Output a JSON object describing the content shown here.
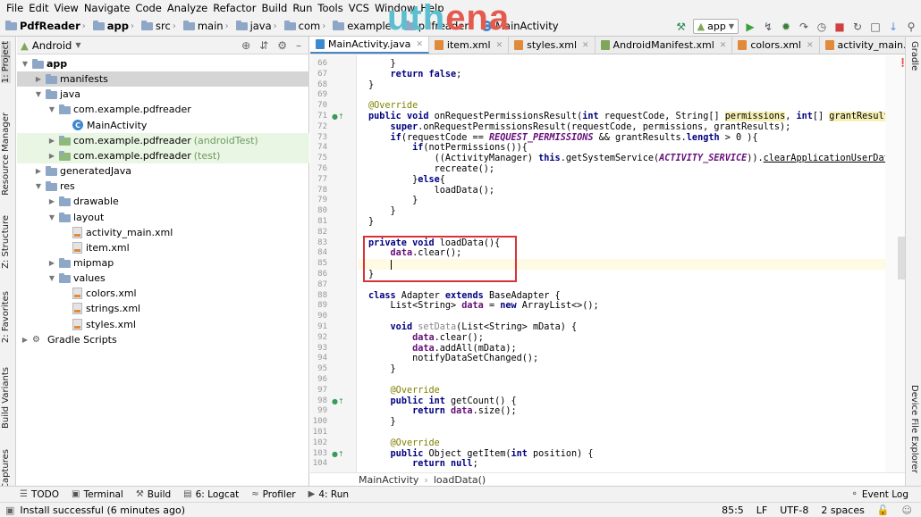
{
  "menu": [
    "File",
    "Edit",
    "View",
    "Navigate",
    "Code",
    "Analyze",
    "Refactor",
    "Build",
    "Run",
    "Tools",
    "VCS",
    "Window",
    "Help"
  ],
  "breadcrumbs": [
    "PdfReader",
    "app",
    "src",
    "main",
    "java",
    "com",
    "example",
    "pdfreader",
    "MainActivity"
  ],
  "watermark": {
    "part1": "uth",
    "part2": "ena"
  },
  "run_config": "app",
  "left_tool_windows": [
    "1: Project",
    "Resource Manager",
    "Z: Structure",
    "2: Favorites",
    "Build Variants",
    "Captures"
  ],
  "right_tool_windows": [
    "Gradle",
    "Device File Explorer"
  ],
  "project": {
    "view_mode": "Android",
    "tree": [
      {
        "label": "app",
        "level": 0,
        "icon": "folder",
        "expanded": true,
        "bold": true
      },
      {
        "label": "manifests",
        "level": 1,
        "icon": "folder",
        "expanded": false,
        "selected": true
      },
      {
        "label": "java",
        "level": 1,
        "icon": "folder",
        "expanded": true
      },
      {
        "label": "com.example.pdfreader",
        "level": 2,
        "icon": "folder",
        "expanded": true
      },
      {
        "label": "MainActivity",
        "level": 3,
        "icon": "class",
        "leaf": true
      },
      {
        "label": "com.example.pdfreader",
        "suffix": "(androidTest)",
        "level": 2,
        "icon": "folder",
        "expanded": false,
        "highlight": true
      },
      {
        "label": "com.example.pdfreader",
        "suffix": "(test)",
        "level": 2,
        "icon": "folder",
        "expanded": false,
        "highlight": true
      },
      {
        "label": "generatedJava",
        "level": 1,
        "icon": "folder",
        "expanded": false
      },
      {
        "label": "res",
        "level": 1,
        "icon": "folder",
        "expanded": true
      },
      {
        "label": "drawable",
        "level": 2,
        "icon": "folder",
        "expanded": false
      },
      {
        "label": "layout",
        "level": 2,
        "icon": "folder",
        "expanded": true
      },
      {
        "label": "activity_main.xml",
        "level": 3,
        "icon": "xml",
        "leaf": true
      },
      {
        "label": "item.xml",
        "level": 3,
        "icon": "xml",
        "leaf": true
      },
      {
        "label": "mipmap",
        "level": 2,
        "icon": "folder",
        "expanded": false
      },
      {
        "label": "values",
        "level": 2,
        "icon": "folder",
        "expanded": true
      },
      {
        "label": "colors.xml",
        "level": 3,
        "icon": "xml",
        "leaf": true
      },
      {
        "label": "strings.xml",
        "level": 3,
        "icon": "xml",
        "leaf": true
      },
      {
        "label": "styles.xml",
        "level": 3,
        "icon": "xml",
        "leaf": true
      },
      {
        "label": "Gradle Scripts",
        "level": 0,
        "icon": "gradle",
        "expanded": false
      }
    ]
  },
  "tabs": [
    {
      "label": "MainActivity.java",
      "active": true,
      "color": "#3c89d0"
    },
    {
      "label": "item.xml",
      "color": "#e08a3a"
    },
    {
      "label": "styles.xml",
      "color": "#e08a3a"
    },
    {
      "label": "AndroidManifest.xml",
      "color": "#7fa65a"
    },
    {
      "label": "colors.xml",
      "color": "#e08a3a"
    },
    {
      "label": "activity_main.xml",
      "color": "#e08a3a"
    }
  ],
  "code": [
    {
      "n": "66",
      "t": "    }",
      "ovr": false
    },
    {
      "n": "67",
      "t": "    «return» «false»;"
    },
    {
      "n": "68",
      "t": "}"
    },
    {
      "n": "69",
      "t": ""
    },
    {
      "n": "70",
      "t": "⟨@Override⟩"
    },
    {
      "n": "71",
      "t": "«public» «void» onRequestPermissionsResult(«int» requestCode, String[] ‹permissions›, «int»[] ‹grantResults›){",
      "ovr": true
    },
    {
      "n": "72",
      "t": "    «super».onRequestPermissionsResult(requestCode, permissions, grantResults);"
    },
    {
      "n": "73",
      "t": "    «if»(requestCode == ⁅REQUEST_PERMISSIONS⁆ && grantResults.«length» > 0 ){"
    },
    {
      "n": "74",
      "t": "        «if»(notPermissions()){"
    },
    {
      "n": "75",
      "t": "            ((ActivityManager) «this».getSystemService(⁅ACTIVITY_SERVICE⁆)).¦clearApplicationUserData¦();"
    },
    {
      "n": "76",
      "t": "            recreate();"
    },
    {
      "n": "77",
      "t": "        }«else»{"
    },
    {
      "n": "78",
      "t": "            loadData();"
    },
    {
      "n": "79",
      "t": "        }"
    },
    {
      "n": "80",
      "t": "    }"
    },
    {
      "n": "81",
      "t": "}"
    },
    {
      "n": "82",
      "t": ""
    },
    {
      "n": "83",
      "t": "«private» «void» loadData(){"
    },
    {
      "n": "84",
      "t": "    ⦃data⦄.clear();"
    },
    {
      "n": "85",
      "t": ""
    },
    {
      "n": "86",
      "t": "}"
    },
    {
      "n": "87",
      "t": ""
    },
    {
      "n": "88",
      "t": "«class» Adapter «extends» BaseAdapter {"
    },
    {
      "n": "89",
      "t": "    List<String> ⦃data⦄ = «new» ArrayList<>();"
    },
    {
      "n": "90",
      "t": ""
    },
    {
      "n": "91",
      "t": "    «void» ⁂setData⁂(List<String> mData) {"
    },
    {
      "n": "92",
      "t": "        ⦃data⦄.clear();"
    },
    {
      "n": "93",
      "t": "        ⦃data⦄.addAll(mData);"
    },
    {
      "n": "94",
      "t": "        notifyDataSetChanged();"
    },
    {
      "n": "95",
      "t": "    }"
    },
    {
      "n": "96",
      "t": ""
    },
    {
      "n": "97",
      "t": "    ⟨@Override⟩"
    },
    {
      "n": "98",
      "t": "    «public» «int» getCount() {",
      "ovr": true
    },
    {
      "n": "99",
      "t": "        «return» ⦃data⦄.size();"
    },
    {
      "n": "100",
      "t": "    }"
    },
    {
      "n": "101",
      "t": ""
    },
    {
      "n": "102",
      "t": "    ⟨@Override⟩"
    },
    {
      "n": "103",
      "t": "    «public» Object getItem(«int» position) {",
      "ovr": true
    },
    {
      "n": "104",
      "t": "        «return» «null»;"
    }
  ],
  "editor_breadcrumb": [
    "MainActivity",
    "loadData()"
  ],
  "bottom_tools": [
    {
      "label": "TODO",
      "icon": "list-icon"
    },
    {
      "label": "Terminal",
      "icon": "terminal-icon"
    },
    {
      "label": "Build",
      "icon": "hammer-icon"
    },
    {
      "label": "6: Logcat",
      "icon": "logcat-icon"
    },
    {
      "label": "Profiler",
      "icon": "profiler-icon"
    },
    {
      "label": "4: Run",
      "icon": "run-icon"
    }
  ],
  "event_log": "Event Log",
  "status": {
    "message": "Install successful (6 minutes ago)",
    "position": "85:5",
    "line_sep": "LF",
    "encoding": "UTF-8",
    "indent": "2 spaces"
  }
}
